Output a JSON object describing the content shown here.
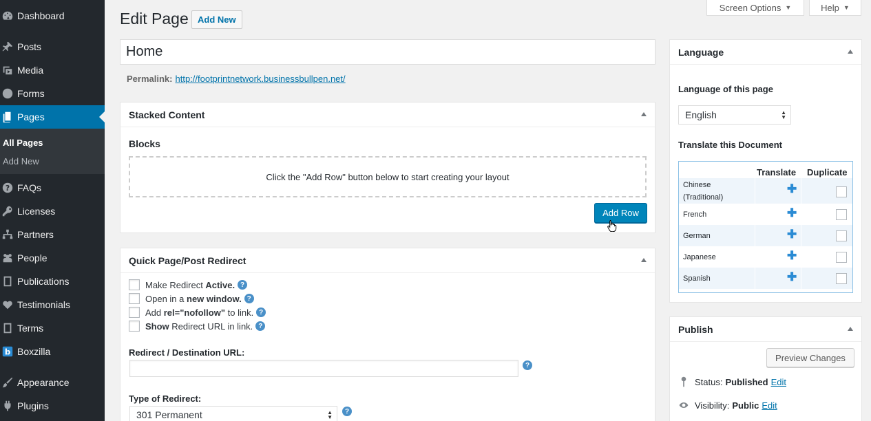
{
  "sidebar": {
    "items": [
      {
        "label": "Dashboard",
        "icon": "dashboard-icon"
      },
      {
        "label": "Posts",
        "icon": "pin-icon"
      },
      {
        "label": "Media",
        "icon": "media-icon"
      },
      {
        "label": "Forms",
        "icon": "forms-icon"
      },
      {
        "label": "Pages",
        "icon": "pages-icon"
      },
      {
        "label": "FAQs",
        "icon": "question-icon"
      },
      {
        "label": "Licenses",
        "icon": "key-icon"
      },
      {
        "label": "Partners",
        "icon": "network-icon"
      },
      {
        "label": "People",
        "icon": "people-icon"
      },
      {
        "label": "Publications",
        "icon": "book-icon"
      },
      {
        "label": "Testimonials",
        "icon": "heart-icon"
      },
      {
        "label": "Terms",
        "icon": "book-icon"
      },
      {
        "label": "Boxzilla",
        "icon": "boxzilla-icon"
      },
      {
        "label": "Appearance",
        "icon": "brush-icon"
      },
      {
        "label": "Plugins",
        "icon": "plug-icon"
      }
    ],
    "submenu": {
      "all_pages": "All Pages",
      "add_new": "Add New"
    }
  },
  "top_tabs": {
    "screen_options": "Screen Options",
    "help": "Help"
  },
  "header": {
    "title": "Edit Page",
    "add_new": "Add New"
  },
  "post_title": "Home",
  "permalink": {
    "label": "Permalink:",
    "url": "http://footprintnetwork.businessbullpen.net/"
  },
  "stacked_content": {
    "title": "Stacked Content",
    "blocks_label": "Blocks",
    "empty_message": "Click the \"Add Row\" button below to start creating your layout",
    "add_row": "Add Row"
  },
  "redirect": {
    "title": "Quick Page/Post Redirect",
    "options": [
      {
        "pre": "Make Redirect ",
        "bold": "Active.",
        "post": ""
      },
      {
        "pre": "Open in a ",
        "bold": "new window.",
        "post": ""
      },
      {
        "pre": "Add ",
        "bold": "rel=\"nofollow\"",
        "post": " to link."
      },
      {
        "pre": "",
        "bold": "Show",
        "post": " Redirect URL in link."
      }
    ],
    "help_symbol": "?",
    "url_label": "Redirect / Destination URL:",
    "url_value": "",
    "type_label": "Type of Redirect:",
    "type_value": "301 Permanent"
  },
  "language": {
    "title": "Language",
    "page_label": "Language of this page",
    "selected": "English",
    "translate_label": "Translate this Document",
    "col_translate": "Translate",
    "col_duplicate": "Duplicate",
    "plus_symbol": "✚",
    "rows": [
      {
        "name": "Chinese (Traditional)"
      },
      {
        "name": "French"
      },
      {
        "name": "German"
      },
      {
        "name": "Japanese"
      },
      {
        "name": "Spanish"
      }
    ]
  },
  "publish": {
    "title": "Publish",
    "preview": "Preview Changes",
    "status_label": "Status:",
    "status_value": "Published",
    "visibility_label": "Visibility:",
    "visibility_value": "Public",
    "edit": "Edit"
  },
  "colors": {
    "accent": "#0073aa",
    "sidebar": "#23282d",
    "button": "#0085ba"
  }
}
